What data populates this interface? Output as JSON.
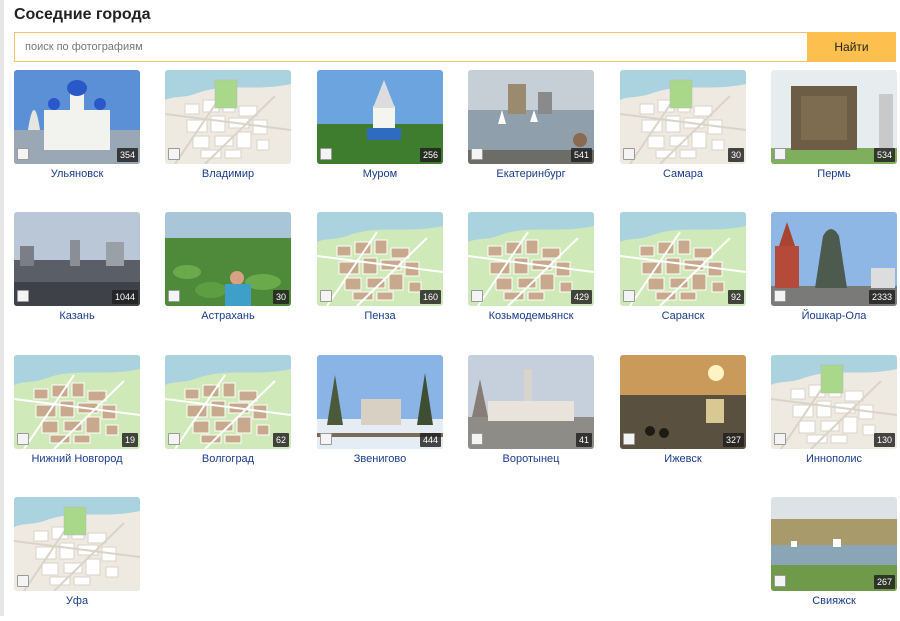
{
  "title": "Соседние города",
  "search": {
    "placeholder": "поиск по фотографиям",
    "button_label": "Найти"
  },
  "colors": {
    "accent": "#fdbf4e",
    "link": "#1a3c8c",
    "input_border": "#f2c46a"
  },
  "cities": [
    {
      "name": "Ульяновск",
      "count": "354",
      "image": "church"
    },
    {
      "name": "Владимир",
      "count": "",
      "image": "map-gray"
    },
    {
      "name": "Муром",
      "count": "256",
      "image": "chapel"
    },
    {
      "name": "Екатеринбург",
      "count": "541",
      "image": "harbor"
    },
    {
      "name": "Самара",
      "count": "30",
      "image": "map-gray"
    },
    {
      "name": "Пермь",
      "count": "534",
      "image": "monument"
    },
    {
      "name": "Казань",
      "count": "1044",
      "image": "skyline"
    },
    {
      "name": "Астрахань",
      "count": "30",
      "image": "lotus"
    },
    {
      "name": "Пенза",
      "count": "160",
      "image": "map-green"
    },
    {
      "name": "Козьмодемьянск",
      "count": "429",
      "image": "map-green"
    },
    {
      "name": "Саранск",
      "count": "92",
      "image": "map-green"
    },
    {
      "name": "Йошкар-Ола",
      "count": "2333",
      "image": "statue"
    },
    {
      "name": "Нижний Новгород",
      "count": "19",
      "image": "map-green"
    },
    {
      "name": "Волгоград",
      "count": "62",
      "image": "map-green"
    },
    {
      "name": "Звенигово",
      "count": "444",
      "image": "winter"
    },
    {
      "name": "Воротынец",
      "count": "41",
      "image": "square"
    },
    {
      "name": "Ижевск",
      "count": "327",
      "image": "sunset"
    },
    {
      "name": "Иннополис",
      "count": "130",
      "image": "map-gray"
    },
    {
      "name": "Уфа",
      "count": "",
      "image": "map-gray"
    },
    {
      "name": "Свияжск",
      "count": "267",
      "image": "river"
    }
  ]
}
